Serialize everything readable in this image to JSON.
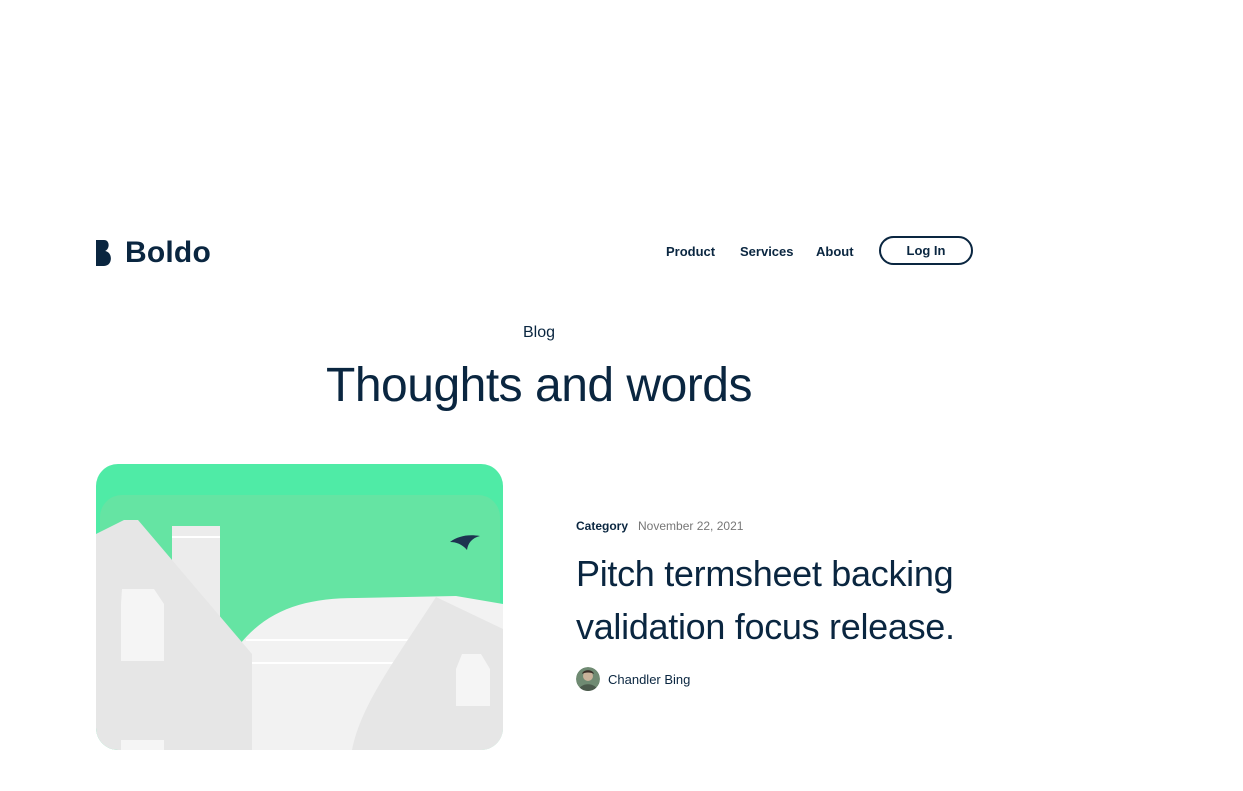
{
  "brand": {
    "name": "Boldo"
  },
  "nav": {
    "items": [
      {
        "label": "Product"
      },
      {
        "label": "Services"
      },
      {
        "label": "About"
      }
    ],
    "login_label": "Log In"
  },
  "hero": {
    "eyebrow": "Blog",
    "title": "Thoughts and words"
  },
  "post": {
    "category": "Category",
    "date": "November 22, 2021",
    "title": "Pitch termsheet backing validation focus release.",
    "author": "Chandler Bing"
  },
  "colors": {
    "primary": "#0A2640",
    "accent_green": "#65E4A3",
    "muted_text": "#777777"
  }
}
